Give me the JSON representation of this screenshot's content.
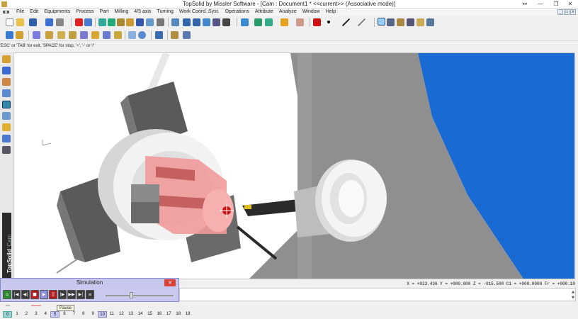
{
  "window": {
    "title": "TopSolid by Missler Software - [Cam : Document1 *  <<current>> (Associative mode)]",
    "controls": {
      "restore": "↔",
      "minimize": "—",
      "maximize": "❐",
      "close": "✕"
    }
  },
  "menu": {
    "items": [
      "File",
      "Edit",
      "Equipments",
      "Process",
      "Part",
      "Milling",
      "4/5 axis",
      "Turning",
      "Work Coord. Syst.",
      "Operations",
      "Attribute",
      "Analyze",
      "Window",
      "Help"
    ],
    "mdi": {
      "minimize": "_",
      "restore": "▫",
      "close": "x"
    }
  },
  "hint": "'ESC' or 'TAB' for exit, 'SPACE' for stop, '+', '-' or '/'",
  "brand": {
    "name": "TopSolid",
    "module": "'Cam"
  },
  "status": {
    "coords": "X = +023.436  Y = +000.000  Z = -015.500   C1 = +000.0000  Fr = +000.10"
  },
  "cmdbox": {
    "arrows": "▲\n▼"
  },
  "simulation": {
    "title": "Simulation",
    "close": "✕",
    "tooltip": "Pause",
    "slider_position": 0.35
  },
  "layers": {
    "current": "0",
    "highlighted": "5",
    "marked": "10",
    "items": [
      "0",
      "1",
      "2",
      "3",
      "4",
      "5",
      "6",
      "7",
      "8",
      "9",
      "10",
      "11",
      "12",
      "13",
      "14",
      "15",
      "16",
      "17",
      "18",
      "19"
    ]
  },
  "colors": {
    "accent_red": "#cc1111",
    "part_pink": "#f29a9a",
    "sky_blue": "#1a6ad4",
    "sim_panel": "#c9c9f0"
  }
}
